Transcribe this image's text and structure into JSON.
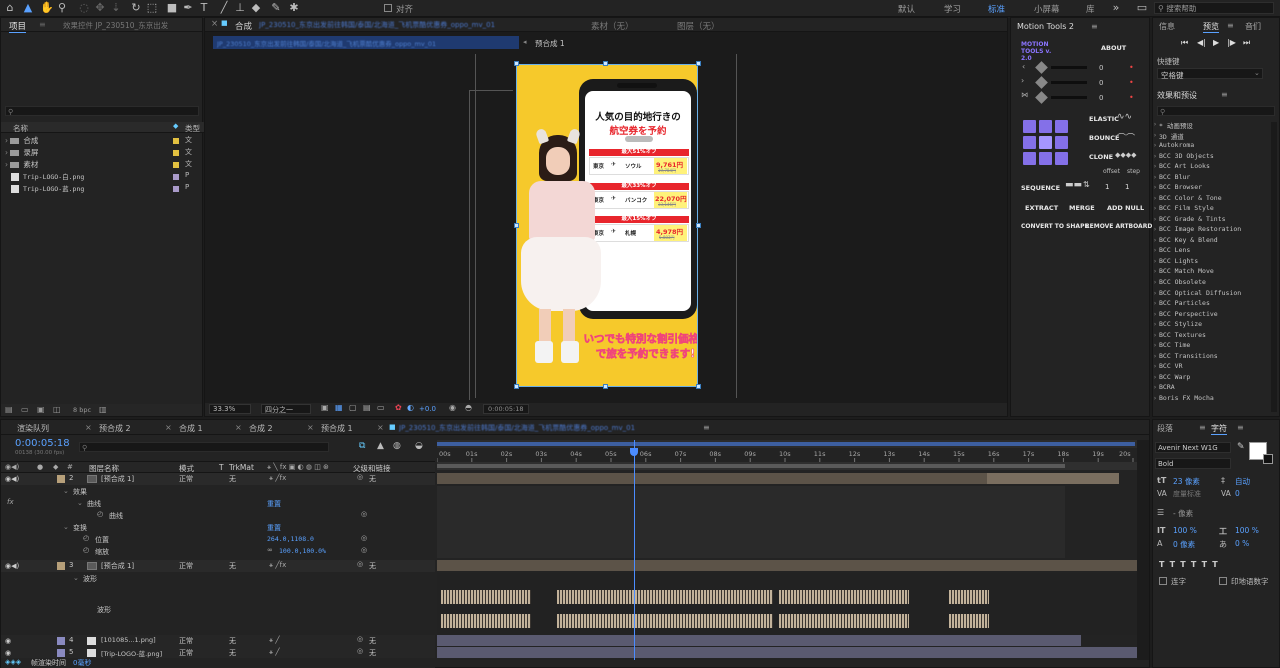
{
  "topbar": {
    "align_label": "对齐",
    "workspaces": [
      "默认",
      "学习",
      "标准",
      "小屏幕",
      "库"
    ],
    "search_placeholder": "搜索帮助"
  },
  "project": {
    "tab": "项目",
    "effects_tab": "效果控件 JP_230510_东京出发",
    "col_name": "名称",
    "col_type": "类型",
    "items": [
      {
        "name": "合成",
        "type": "文",
        "kind": "folder",
        "color": "#e2c040"
      },
      {
        "name": "录屏",
        "type": "文",
        "kind": "folder",
        "color": "#e2c040"
      },
      {
        "name": "素材",
        "type": "文",
        "kind": "folder",
        "color": "#e2c040"
      },
      {
        "name": "Trip-LOGO-白.png",
        "type": "P",
        "kind": "file",
        "color": "#a99ac9"
      },
      {
        "name": "Trip-LOGO-蓝.png",
        "type": "P",
        "kind": "file",
        "color": "#a99ac9"
      }
    ],
    "bpc": "8 bpc"
  },
  "viewer": {
    "tab_label": "合成",
    "comp_name": "JP_230510_东京出发前往韩国/泰国/北海道_飞机票酷优惠券_oppo_mv_01",
    "footage_label": "素材（无）",
    "layer_label": "图层（无）",
    "breadcrumb_comp": "JP_230510_东京出发前往韩国/泰国/北海道_飞机票酷优惠券_oppo_mv_01",
    "breadcrumb_precomp": "预合成 1",
    "zoom": "33.3%",
    "resolution": "四分之一",
    "exposure": "+0.0",
    "timecode": "0:00:05:18"
  },
  "ad": {
    "headline": "人気の目的地行きの",
    "headline2": "航空券を予約",
    "deals": [
      {
        "badge": "最大51%オフ",
        "from": "東京",
        "to": "ソウル",
        "price": "9,761円",
        "old": "19,784円"
      },
      {
        "badge": "最大33%オフ",
        "from": "東京",
        "to": "バンコク",
        "price": "22,070円",
        "old": "33,146円"
      },
      {
        "badge": "最大15%オフ",
        "from": "東京",
        "to": "札幌",
        "price": "4,978円",
        "old": "5,883円"
      }
    ],
    "tagline1": "いつでも特別な割引価格",
    "tagline2": "で旅を予約できます!",
    "colors": {
      "bg": "#f6c92b",
      "red": "#e8252c",
      "pink": "#f0457a"
    }
  },
  "motion_tools": {
    "title": "Motion Tools 2",
    "logo": "MOTION TOOLS v. 2.0",
    "about": "ABOUT",
    "values": [
      "0",
      "0",
      "0"
    ],
    "elastic": "ELASTIC",
    "bounce": "BOUNCE",
    "clone": "CLONE",
    "offset": "offset",
    "step": "step",
    "sequence": "SEQUENCE",
    "seq_offset": "1",
    "seq_step": "1",
    "extract": "EXTRACT",
    "merge": "MERGE",
    "add_null": "ADD NULL",
    "convert_to_shape": "CONVERT TO SHAPE",
    "remove_artboard": "REMOVE ARTBOARD"
  },
  "info_panel": {
    "tabs": [
      "信息",
      "预览",
      "音们"
    ],
    "shortcut_label": "快捷键",
    "shortcut_value": "空格键"
  },
  "effects_presets": {
    "title": "效果和预设",
    "items": [
      "* 动画预设",
      "3D 通道",
      "Autokroma",
      "BCC 3D Objects",
      "BCC Art Looks",
      "BCC Blur",
      "BCC Browser",
      "BCC Color & Tone",
      "BCC Film Style",
      "BCC Grade & Tints",
      "BCC Image Restoration",
      "BCC Key & Blend",
      "BCC Lens",
      "BCC Lights",
      "BCC Match Move",
      "BCC Obsolete",
      "BCC Optical Diffusion",
      "BCC Particles",
      "BCC Perspective",
      "BCC Stylize",
      "BCC Textures",
      "BCC Time",
      "BCC Transitions",
      "BCC VR",
      "BCC Warp",
      "BCRA",
      "Boris FX Mocha"
    ]
  },
  "timeline": {
    "tabs": [
      "渲染队列",
      "预合成 2",
      "合成 1",
      "合成 2",
      "预合成 1"
    ],
    "active_comp": "JP_230510_东京出发前往韩国/泰国/北海道_飞机票酷优惠券_oppo_mv_01",
    "timecode": "0:00:05:18",
    "frame_info": "00138 (30.00 fps)",
    "col_layer_name": "图层名称",
    "col_mode": "模式",
    "col_t": "T",
    "col_trkmat": "TrkMat",
    "col_parent": "父级和链接",
    "ruler": [
      "00s",
      "01s",
      "02s",
      "03s",
      "04s",
      "05s",
      "06s",
      "07s",
      "08s",
      "09s",
      "10s",
      "11s",
      "12s",
      "13s",
      "14s",
      "15s",
      "16s",
      "17s",
      "18s",
      "19s",
      "20s"
    ],
    "playhead_fraction": 0.283,
    "layers": [
      {
        "num": "2",
        "name": "[预合成 1]",
        "mode": "正常",
        "trkmat": "无",
        "parent": "无",
        "color": "#b7a07a"
      },
      {
        "num": "3",
        "name": "[预合成 1]",
        "mode": "正常",
        "trkmat": "无",
        "parent": "无",
        "color": "#b7a07a"
      },
      {
        "num": "4",
        "name": "[101085...1.png]",
        "mode": "正常",
        "trkmat": "无",
        "parent": "无",
        "color": "#8a8ac0"
      },
      {
        "num": "5",
        "name": "[Trip-LOGO-蓝.png]",
        "mode": "正常",
        "trkmat": "无",
        "parent": "无",
        "color": "#8a8ac0"
      }
    ],
    "props": {
      "effects": "效果",
      "curves": "曲线",
      "curves_inner": "曲线",
      "reset": "重置",
      "transform": "变换",
      "position": "位置",
      "position_value": "264.0,1108.0",
      "scale": "缩放",
      "scale_value": "100.0,100.0%",
      "waveform": "波形",
      "waveform2": "波形"
    },
    "render_time_label": "帧渲染时间",
    "render_time_value": "0毫秒"
  },
  "right_bottom": {
    "paragraph_tab": "段落",
    "character_tab": "字符",
    "font": "Avenir Next W1G",
    "style": "Bold",
    "size": "23 像素",
    "leading": "自动",
    "tracking_label": "度量标准",
    "tracking": "0",
    "stroke": "- 像素",
    "vscale": "100 %",
    "hscale": "100 %",
    "baseline": "0 像素",
    "tsume": "0 %",
    "ligatures": "连字",
    "hindi": "印地语数字"
  }
}
